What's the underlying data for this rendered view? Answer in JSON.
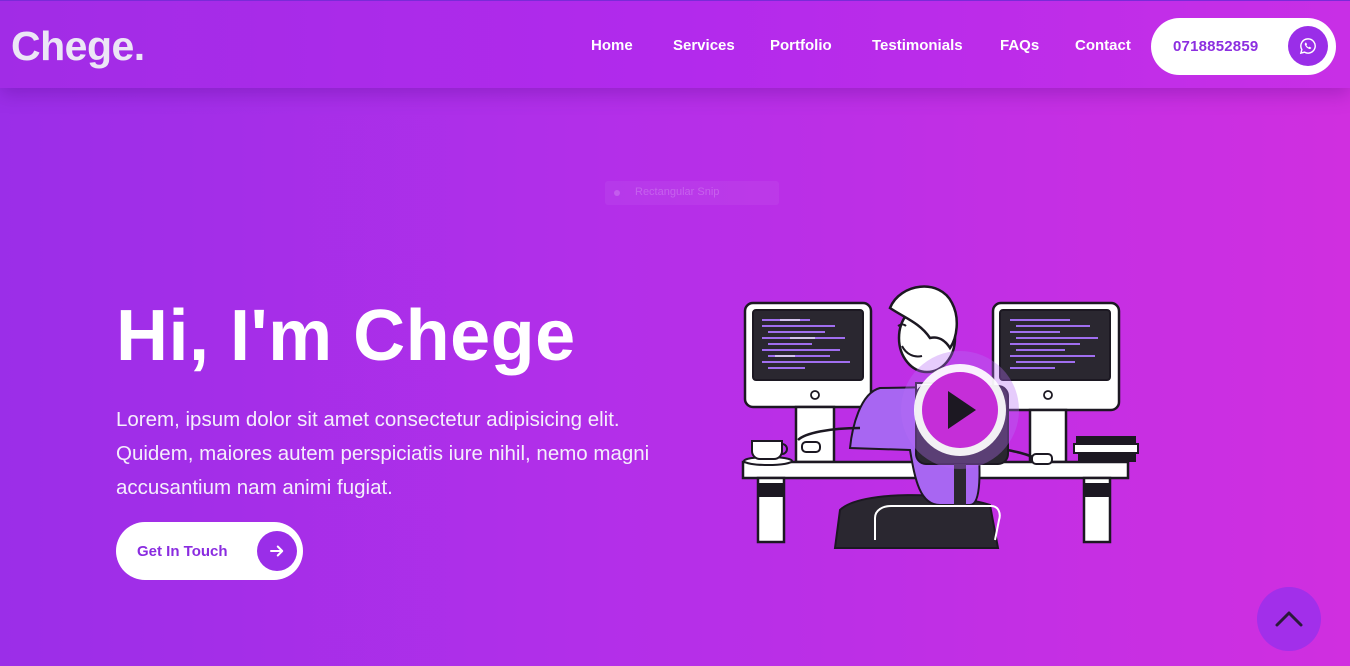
{
  "brand": {
    "logo": "Chege."
  },
  "nav": {
    "items": [
      {
        "label": "Home"
      },
      {
        "label": "Services"
      },
      {
        "label": "Portfolio"
      },
      {
        "label": "Testimonials"
      },
      {
        "label": "FAQs"
      },
      {
        "label": "Contact"
      }
    ],
    "phone": "0718852859",
    "phone_icon": "whatsapp-icon"
  },
  "ghost_tag": {
    "label": "Rectangular Snip"
  },
  "hero": {
    "title": "Hi, I'm Chege",
    "description": "Lorem, ipsum dolor sit amet consectetur adipisicing elit. Quidem, maiores autem perspiciatis iure nihil, nemo magni accusantium nam animi fugiat.",
    "cta_label": "Get In Touch",
    "cta_icon": "arrow-right-icon",
    "play_icon": "play-icon"
  },
  "scroll_top_icon": "chevron-up-icon",
  "colors": {
    "accent": "#9a2ee8",
    "gradient_start": "#9b2ee8",
    "gradient_end": "#d02fe0"
  }
}
